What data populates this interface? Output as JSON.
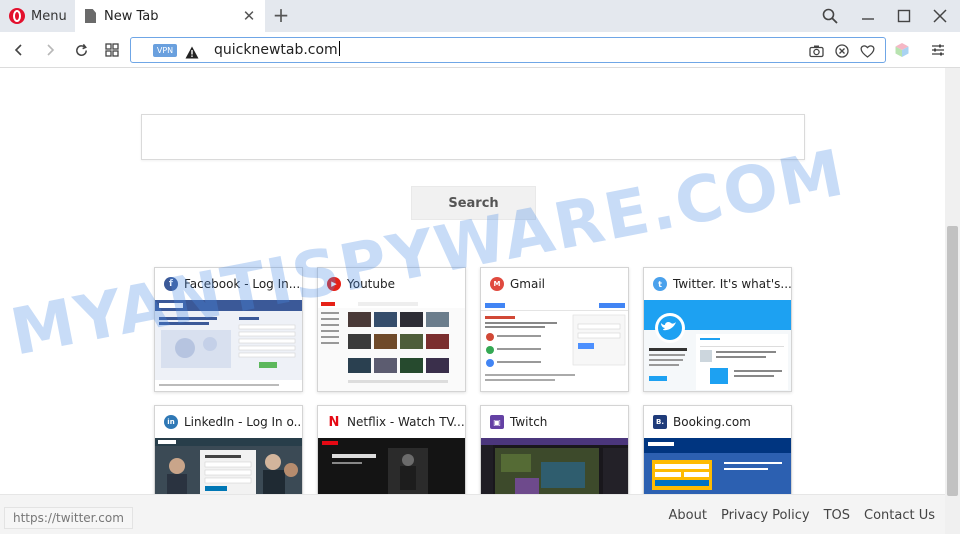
{
  "browser": {
    "menu_label": "Menu",
    "tab_title": "New Tab",
    "url": "quicknewtab.com",
    "vpn_label": "VPN",
    "accent": "#e3102d"
  },
  "page": {
    "search_placeholder": "",
    "search_button": "Search",
    "speed_dials": [
      {
        "title": "Facebook - Log In...",
        "icon": "facebook-icon",
        "color": "#3b5998",
        "glyph": "f"
      },
      {
        "title": "Youtube",
        "icon": "youtube-icon",
        "color": "#e62117",
        "glyph": "▶"
      },
      {
        "title": "Gmail",
        "icon": "gmail-icon",
        "color": "#e04a3f",
        "glyph": "M"
      },
      {
        "title": "Twitter. It's what's...",
        "icon": "twitter-icon",
        "color": "#4aa1ec",
        "glyph": "t"
      },
      {
        "title": "LinkedIn - Log In o...",
        "icon": "linkedin-icon",
        "color": "#2f78b5",
        "glyph": "in"
      },
      {
        "title": "Netflix - Watch TV...",
        "icon": "netflix-icon",
        "color": "#e50914",
        "glyph": "N"
      },
      {
        "title": "Twitch",
        "icon": "twitch-icon",
        "color": "#6441a4",
        "glyph": "▣"
      },
      {
        "title": "Booking.com",
        "icon": "booking-icon",
        "color": "#1f3b7a",
        "glyph": "B."
      }
    ],
    "status_url": "https://twitter.com",
    "footer_links": [
      "About",
      "Privacy Policy",
      "TOS",
      "Contact Us"
    ]
  },
  "watermark": "MYANTISPYWARE.COM"
}
